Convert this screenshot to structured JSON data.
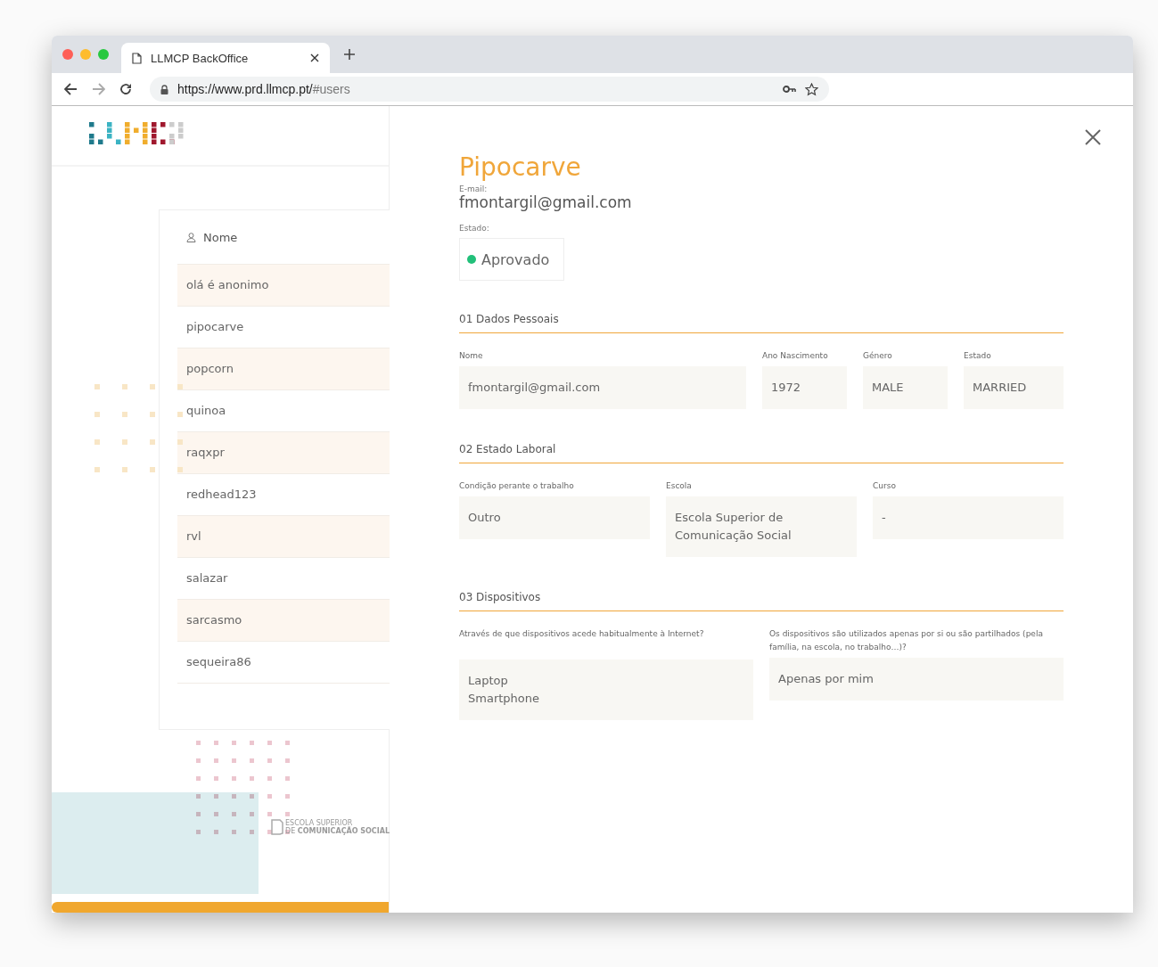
{
  "browser": {
    "tab_title": "LLMCP BackOffice",
    "url_host": "https://www.prd.llmcp.pt/",
    "url_path": "#users"
  },
  "users_list": {
    "header": "Nome",
    "items": [
      "olá é anonimo",
      "pipocarve",
      "popcorn",
      "quinoa",
      "raqxpr",
      "redhead123",
      "rvl",
      "salazar",
      "sarcasmo",
      "sequeira86"
    ]
  },
  "footer_logo": {
    "line_1": "ESCOLA SUPERIOR",
    "line_2_prefix": "DE",
    "line_2_bold": "COMUNICAÇÃO SOCIAL"
  },
  "detail": {
    "title": "Pipocarve",
    "email_label": "E-mail:",
    "email": "fmontargil@gmail.com",
    "status_label": "Estado:",
    "status": {
      "label": "Aprovado",
      "color": "#22c07a"
    },
    "sections": [
      {
        "title": "01 Dados Pessoais",
        "fields": [
          {
            "label": "Nome",
            "lines": [
              "fmontargil@gmail.com"
            ]
          },
          {
            "label": "Ano Nascimento",
            "lines": [
              "1972"
            ]
          },
          {
            "label": "Género",
            "lines": [
              "MALE"
            ]
          },
          {
            "label": "Estado",
            "lines": [
              "MARRIED"
            ]
          }
        ]
      },
      {
        "title": "02 Estado Laboral",
        "fields": [
          {
            "label": "Condição perante o trabalho",
            "lines": [
              "Outro"
            ]
          },
          {
            "label": "Escola",
            "lines": [
              "Escola Superior de",
              "Comunicação Social"
            ]
          },
          {
            "label": "Curso",
            "lines": [
              "-"
            ]
          }
        ]
      },
      {
        "title": "03 Dispositivos",
        "fields": [
          {
            "label": "Através de que dispositivos acede habitualmente à Internet?",
            "lines": [
              "Laptop",
              "Smartphone"
            ]
          },
          {
            "label": "Os dispositivos são utilizados apenas por si ou são partilhados (pela família, na escola, no trabalho…)?",
            "lines": [
              "Apenas por mim"
            ]
          }
        ]
      }
    ]
  }
}
